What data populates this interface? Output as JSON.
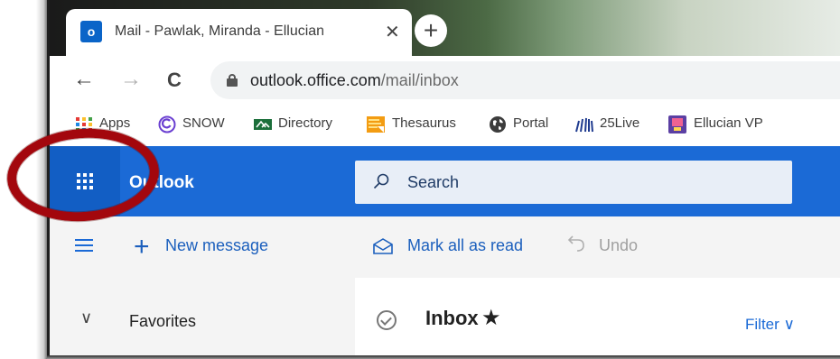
{
  "browser": {
    "tab": {
      "favicon_letter": "o",
      "title": "Mail - Pawlak, Miranda - Ellucian",
      "close_glyph": "✕"
    },
    "new_tab_glyph": "+",
    "nav": {
      "back": "←",
      "forward": "→",
      "reload": "C"
    },
    "address": {
      "host": "outlook.office.com",
      "path": "/mail/inbox"
    },
    "bookmarks": [
      {
        "label": "Apps",
        "icon": "apps-grid-icon"
      },
      {
        "label": "SNOW",
        "icon": "snow-icon"
      },
      {
        "label": "Directory",
        "icon": "directory-icon"
      },
      {
        "label": "Thesaurus",
        "icon": "thesaurus-icon"
      },
      {
        "label": "Portal",
        "icon": "globe-icon"
      },
      {
        "label": "25Live",
        "icon": "25live-icon"
      },
      {
        "label": "Ellucian VP",
        "icon": "ellucian-icon"
      }
    ]
  },
  "outlook": {
    "brand": "Outlook",
    "search_label": "Search",
    "commands": {
      "new_message": "New message",
      "mark_all_read": "Mark all as read",
      "undo": "Undo"
    },
    "folders": {
      "favorites_label": "Favorites"
    },
    "list": {
      "title": "Inbox",
      "star": "★",
      "filter_label": "Filter ∨"
    }
  },
  "colors": {
    "outlook_header": "#1b6ad6",
    "waffle_box": "#125ec4",
    "highlight_ring": "#a3070d"
  }
}
